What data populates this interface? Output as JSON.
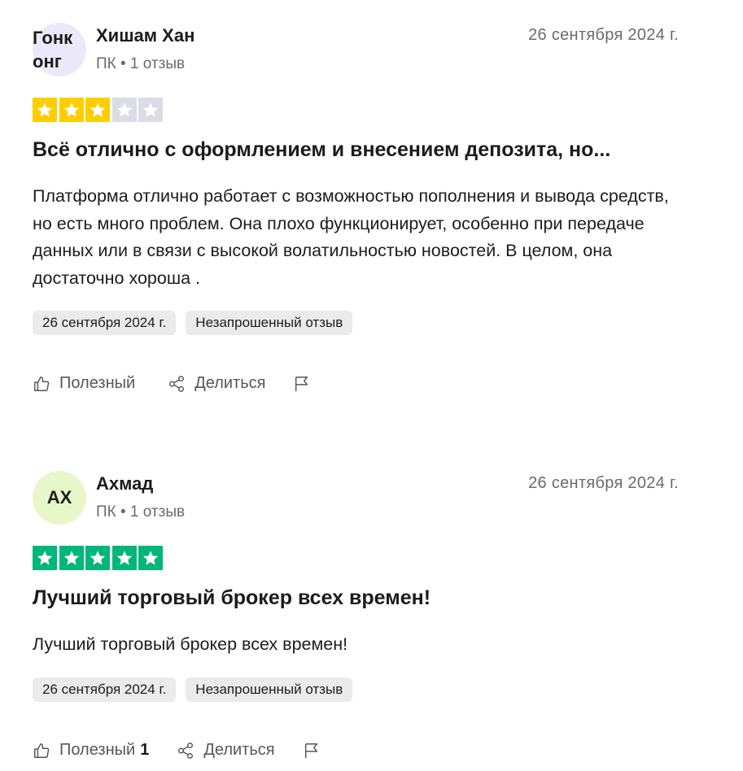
{
  "reviews": [
    {
      "avatar_text": "Гонк\nонг",
      "avatar_color": "#ebe9f9",
      "name": "Хишам Хан",
      "meta": "ПК • 1 отзыв",
      "date": "26 сентября 2024 г.",
      "rating": 3,
      "star_color": "#ffce00",
      "title": "Всё отлично с оформлением и внесением депозита, но...",
      "body": "Платформа отлично работает с возможностью пополнения и вывода средств, но есть много проблем. Она плохо функционирует, особенно при передаче данных или в связи с высокой волатильностью новостей. В целом, она достаточно хороша .",
      "tag_date": "26 сентября 2024 г.",
      "tag_type": "Незапрошенный отзыв",
      "helpful_label": "Полезный",
      "helpful_count": "",
      "share_label": "Делиться"
    },
    {
      "avatar_text": "AX",
      "avatar_color": "#e8f7c9",
      "name": "Ахмад",
      "meta": "ПК • 1 отзыв",
      "date": "26 сентября 2024 г.",
      "rating": 5,
      "star_color": "#00b67a",
      "title": "Лучший торговый брокер всех времен!",
      "body": "Лучший торговый брокер всех времен!",
      "tag_date": "26 сентября 2024 г.",
      "tag_type": "Незапрошенный отзыв",
      "helpful_label": "Полезный",
      "helpful_count": "1",
      "share_label": "Делиться"
    }
  ],
  "icons": {
    "helpful": "thumbs-up-icon",
    "share": "share-icon",
    "report": "flag-icon",
    "star": "star-icon"
  },
  "empty_star_color": "#dcdce6"
}
